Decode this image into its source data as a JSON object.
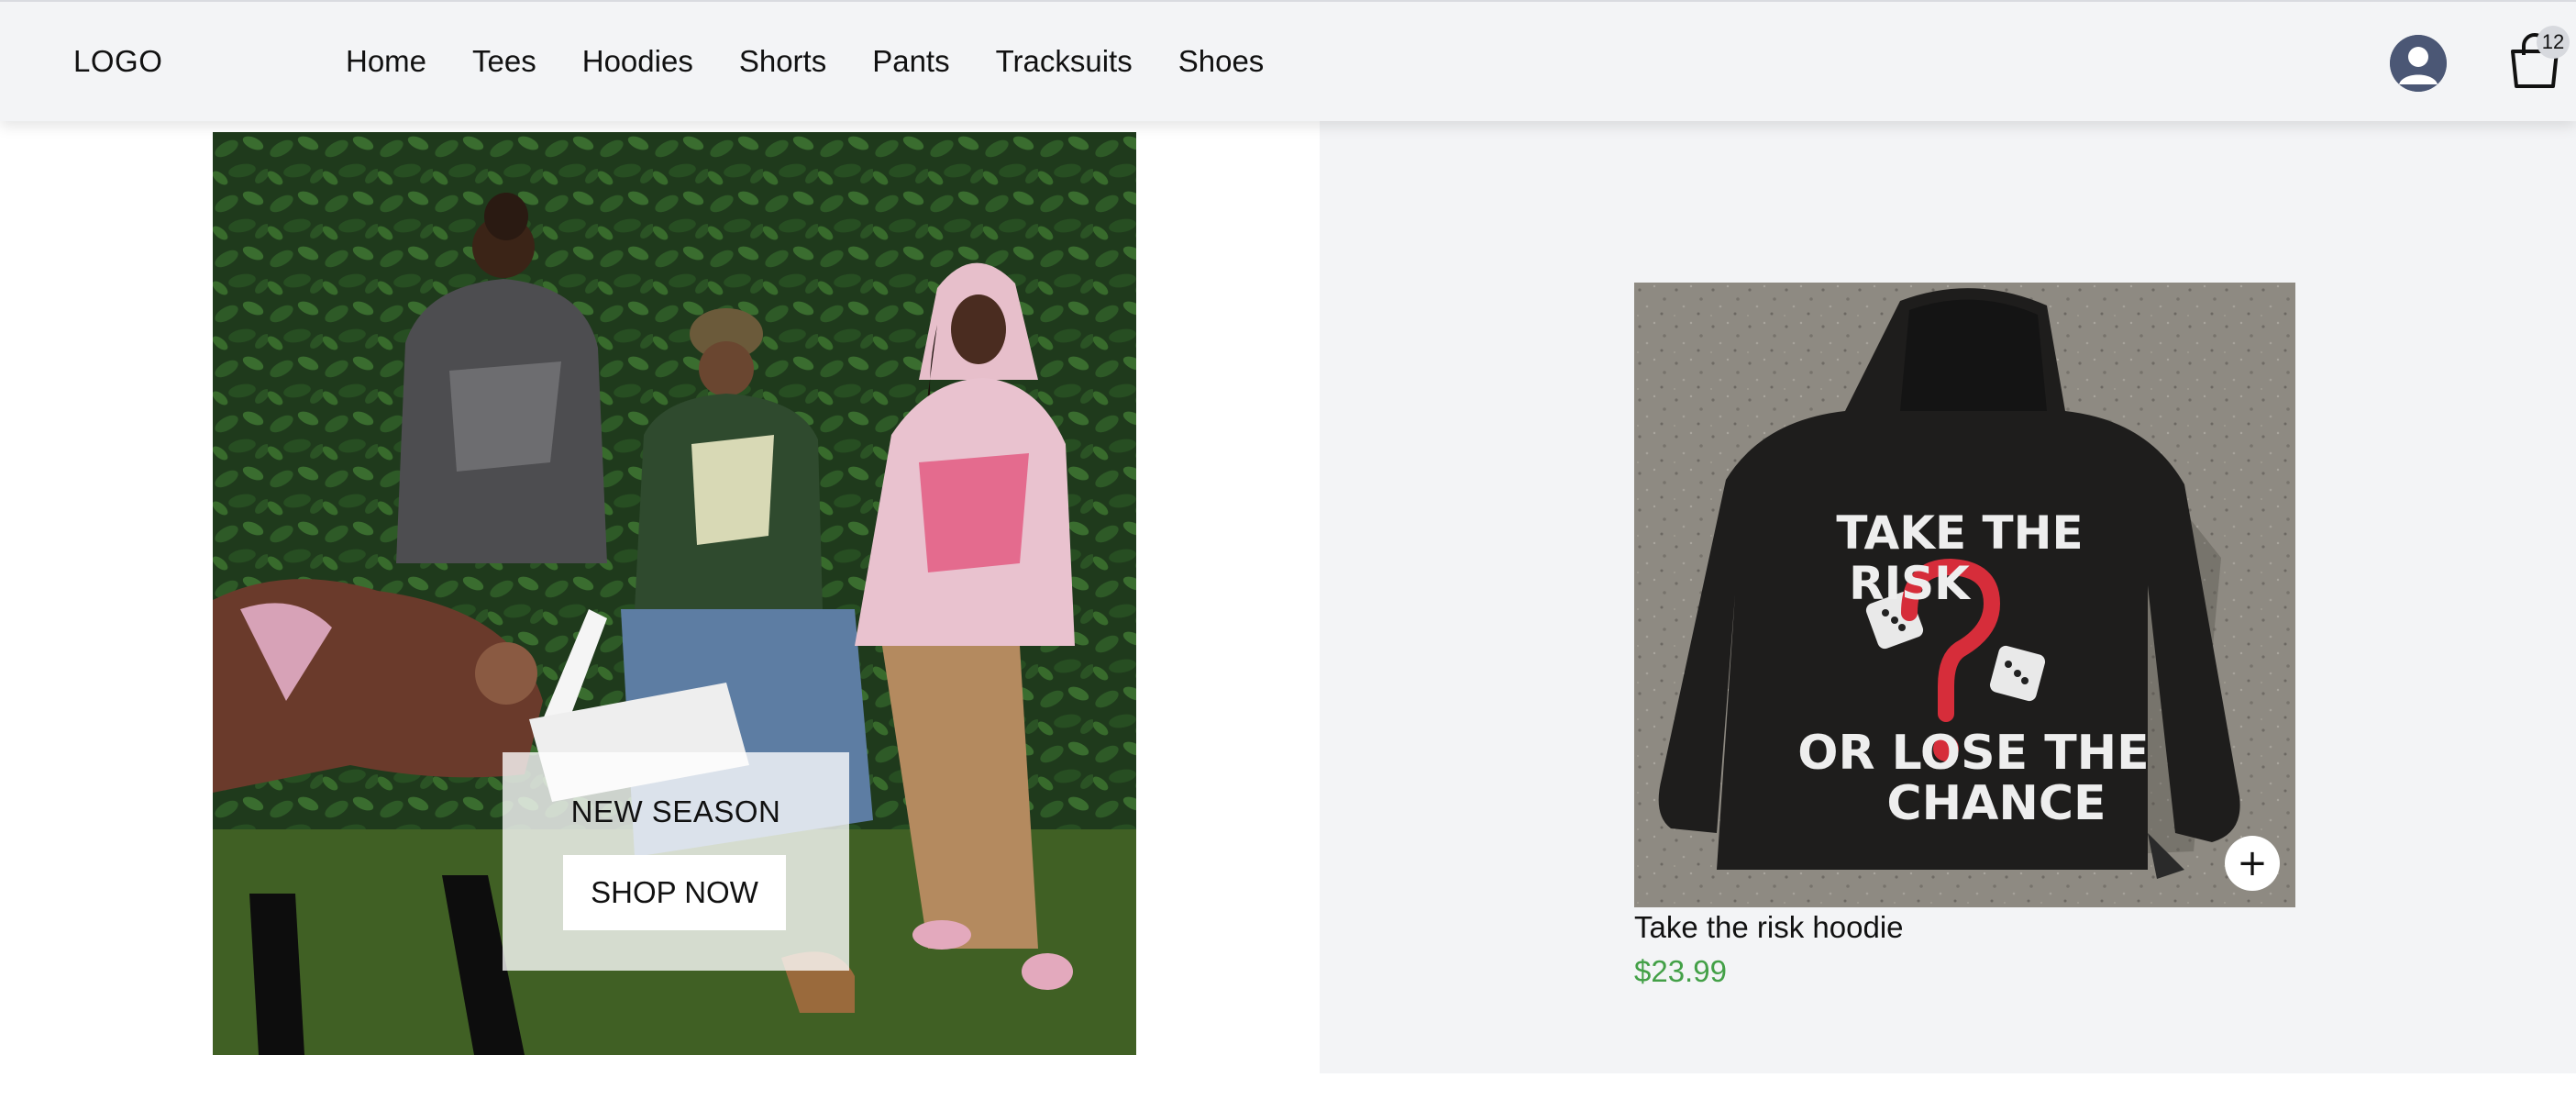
{
  "header": {
    "logo": "LOGO",
    "nav": [
      "Home",
      "Tees",
      "Hoodies",
      "Shorts",
      "Pants",
      "Tracksuits",
      "Shoes"
    ],
    "cart_count": "12",
    "icons": {
      "account": "user-avatar-icon",
      "cart": "shopping-bag-icon"
    }
  },
  "hero": {
    "title": "NEW SEASON",
    "button": "SHOP NOW",
    "image": "group of five models in graphic hoodies against a leafy green wall"
  },
  "product": {
    "name": "Take the risk hoodie",
    "price": "$23.99",
    "image": "black hoodie laid flat on concrete",
    "print_text": [
      "TAKE THE",
      "RISK",
      "OR LOSE THE",
      "CHANCE"
    ],
    "add_icon": "plus-icon"
  },
  "colors": {
    "header_bg": "#f3f4f6",
    "panel_bg": "#f3f4f6",
    "price": "#43a047",
    "avatar": "#4b5775"
  }
}
